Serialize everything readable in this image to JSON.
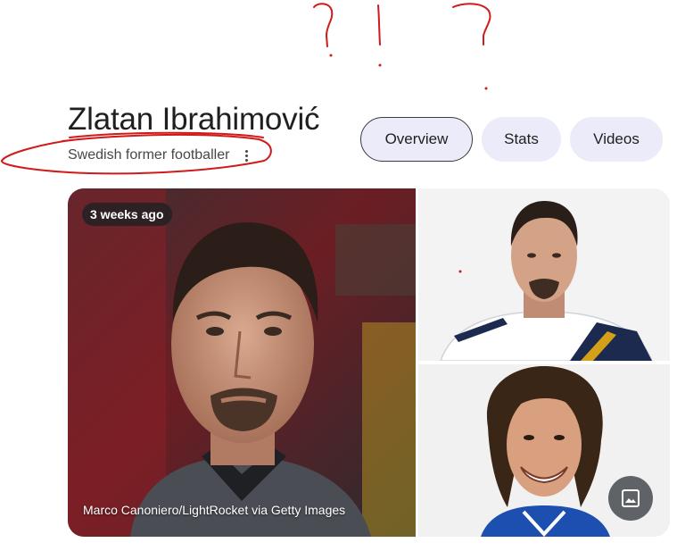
{
  "entity": {
    "name": "Zlatan Ibrahimović",
    "description": "Swedish former footballer"
  },
  "tabs": [
    {
      "label": "Overview",
      "selected": true
    },
    {
      "label": "Stats",
      "selected": false
    },
    {
      "label": "Videos",
      "selected": false
    }
  ],
  "gallery": {
    "main_photo": {
      "age_badge": "3 weeks ago",
      "credit": "Marco Canoniero/LightRocket via Getty Images"
    },
    "image_button_icon": "image-icon"
  },
  "annotation_color": "#d11a1a"
}
